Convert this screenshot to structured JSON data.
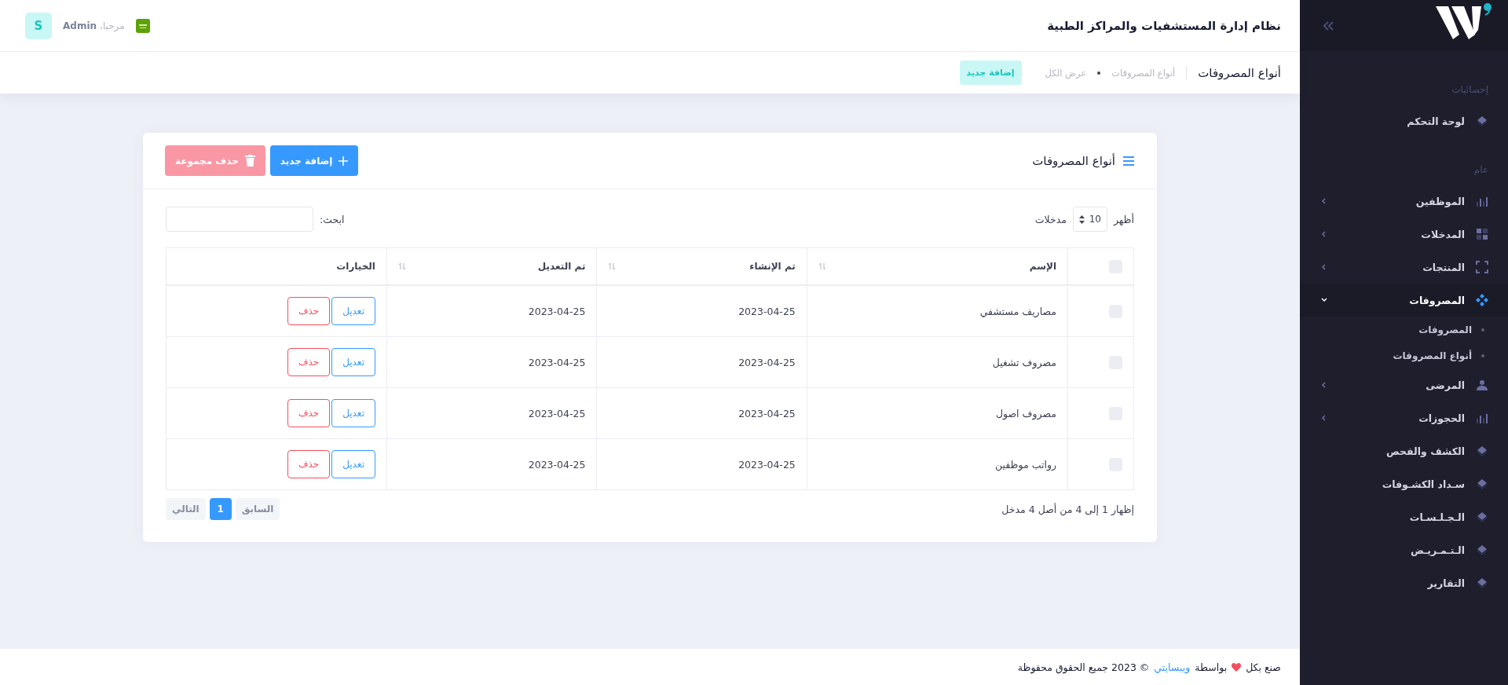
{
  "header": {
    "title": "نظام إدارة المستشفيات والمراكز الطبية",
    "greeting": "مرحبا،",
    "user": "Admin",
    "avatar": "S"
  },
  "subheader": {
    "title": "أنواع المصروفات",
    "breadcrumb": [
      "أنواع المصروفات",
      "عرض الكل"
    ],
    "button": "إضافة جديد"
  },
  "sidebar": {
    "sections": [
      {
        "label": "إحصائيات",
        "items": [
          {
            "kind": "link",
            "label": "لوحة التحكم",
            "selected": false
          }
        ]
      },
      {
        "label": "عام",
        "items": [
          {
            "kind": "group",
            "label": "الموظفين",
            "selected": false,
            "expanded": false
          },
          {
            "kind": "group",
            "label": "المدخلات",
            "selected": false,
            "expanded": false
          },
          {
            "kind": "group",
            "label": "المنتجات",
            "selected": false,
            "expanded": false
          },
          {
            "kind": "group",
            "label": "المصروفات",
            "selected": true,
            "expanded": true,
            "children": [
              {
                "label": "المصروفات"
              },
              {
                "label": "أنواع المصروفات"
              }
            ]
          },
          {
            "kind": "group",
            "label": "المرضى",
            "selected": false,
            "expanded": false
          },
          {
            "kind": "group",
            "label": "الحجوزات",
            "selected": false,
            "expanded": false
          },
          {
            "kind": "link",
            "label": "الكشف والفحص",
            "selected": false
          },
          {
            "kind": "link",
            "label": "سـداد الكشـوفات",
            "selected": false
          },
          {
            "kind": "link",
            "label": "الـجـلـسـات",
            "selected": false
          },
          {
            "kind": "link",
            "label": "الـتـمـريـض",
            "selected": false
          },
          {
            "kind": "link",
            "label": "التقارير",
            "selected": false
          }
        ]
      }
    ]
  },
  "card": {
    "title": "أنواع المصروفات",
    "buttons": [
      {
        "kind": "primary",
        "label": "إضافة جديد"
      },
      {
        "kind": "danger",
        "label": "حذف مجموعة"
      }
    ],
    "show": {
      "before": "أظهر",
      "value": "10",
      "after": "مدخلات"
    },
    "search": {
      "label": "ابحث:"
    },
    "table": {
      "header_checked": false,
      "columns": [
        "الإسم",
        "تم الإنشاء",
        "تم التعديل",
        "الخيارات"
      ],
      "rows": [
        {
          "checked": false,
          "name": "مصاريف مستشفي",
          "created": "2023-04-25",
          "modified": "2023-04-25",
          "actions": [
            "تعديل",
            "حذف"
          ]
        },
        {
          "checked": false,
          "name": "مصروف تشغيل",
          "created": "2023-04-25",
          "modified": "2023-04-25",
          "actions": [
            "تعديل",
            "حذف"
          ]
        },
        {
          "checked": false,
          "name": "مصروف اصول",
          "created": "2023-04-25",
          "modified": "2023-04-25",
          "actions": [
            "تعديل",
            "حذف"
          ]
        },
        {
          "checked": false,
          "name": "رواتب موظفين",
          "created": "2023-04-25",
          "modified": "2023-04-25",
          "actions": [
            "تعديل",
            "حذف"
          ]
        }
      ]
    },
    "info": "إظهار 1 إلى 4 من أصل 4 مدخل",
    "pagination": [
      {
        "label": "السابق",
        "disabled": true,
        "selected": false
      },
      {
        "label": "1",
        "disabled": false,
        "selected": true
      },
      {
        "label": "التالي",
        "disabled": true,
        "selected": false
      }
    ]
  },
  "footer": {
    "made": "صنع بكل",
    "by": "بواسطة",
    "link": "ويبسايتي",
    "rights": "© 2023 جميع الحقوق محفوظة"
  }
}
